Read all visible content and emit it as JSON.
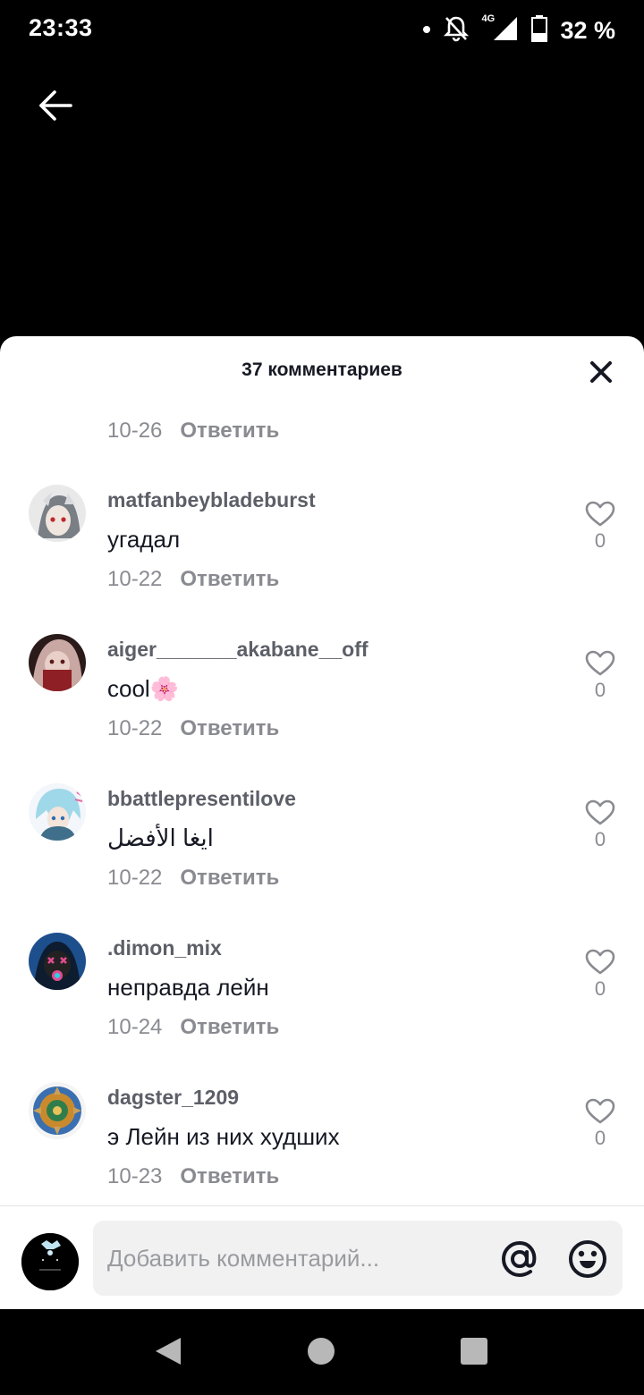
{
  "status_bar": {
    "time": "23:33",
    "network": "4G",
    "battery": "32 %"
  },
  "sheet": {
    "title": "37 комментариев"
  },
  "partial_comment": {
    "date": "10-26",
    "reply_label": "Ответить"
  },
  "comments": [
    {
      "username": "matfanbeybladeburst",
      "text": "угадал",
      "date": "10-22",
      "reply_label": "Ответить",
      "likes": "0",
      "avatar_color": "#7a7f86"
    },
    {
      "username": "aiger_______akabane__off",
      "text": "cool🌸",
      "date": "10-22",
      "reply_label": "Ответить",
      "likes": "0",
      "avatar_color": "#8e3b3b"
    },
    {
      "username": "bbattlepresentilove",
      "text": "ايغا الأفضل",
      "date": "10-22",
      "reply_label": "Ответить",
      "likes": "0",
      "avatar_color": "#9fd8e8"
    },
    {
      "username": ".dimon_mix",
      "text": "неправда лейн",
      "date": "10-24",
      "reply_label": "Ответить",
      "likes": "0",
      "avatar_color": "#1d4f8c"
    },
    {
      "username": "dagster_1209",
      "text": "э Лейн из них худших",
      "date": "10-23",
      "reply_label": "Ответить",
      "likes": "0",
      "avatar_color": "#c98a2e"
    }
  ],
  "composer": {
    "placeholder": "Добавить комментарий..."
  },
  "colors": {
    "accent_text": "#161823",
    "muted_text": "#8a8b91",
    "username_text": "#5c5f67"
  }
}
